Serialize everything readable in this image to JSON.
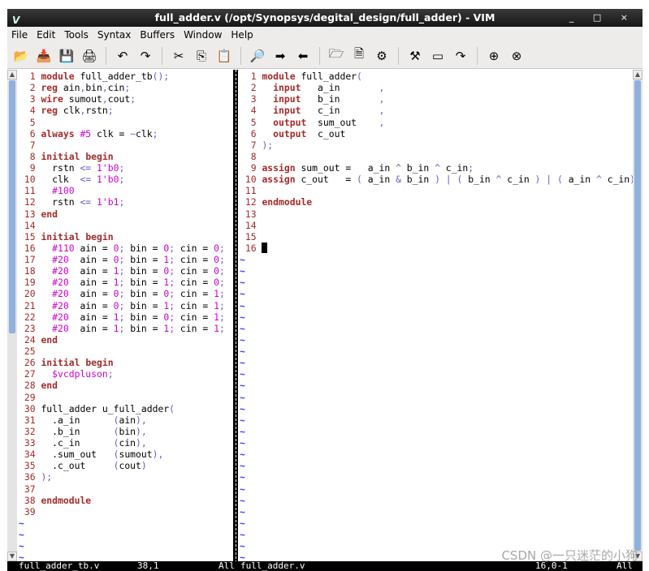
{
  "window": {
    "title": "full_adder.v (/opt/Synopsys/degital_design/full_adder) - VIM",
    "controls": "_ □ ×"
  },
  "menu": [
    "File",
    "Edit",
    "Tools",
    "Syntax",
    "Buffers",
    "Window",
    "Help"
  ],
  "toolbar": [
    {
      "name": "open-icon",
      "glyph": "📂"
    },
    {
      "name": "save-download-icon",
      "glyph": "📥"
    },
    {
      "name": "save-icon",
      "glyph": "💾"
    },
    {
      "name": "print-icon",
      "glyph": "🖨"
    },
    {
      "sep": true
    },
    {
      "name": "undo-icon",
      "glyph": "↶"
    },
    {
      "name": "redo-icon",
      "glyph": "↷"
    },
    {
      "sep": true
    },
    {
      "name": "cut-icon",
      "glyph": "✂"
    },
    {
      "name": "copy-icon",
      "glyph": "⎘"
    },
    {
      "name": "paste-icon",
      "glyph": "📋"
    },
    {
      "sep": true
    },
    {
      "name": "find-replace-icon",
      "glyph": "🔎"
    },
    {
      "name": "find-next-icon",
      "glyph": "➡"
    },
    {
      "name": "find-prev-icon",
      "glyph": "⬅"
    },
    {
      "sep": true
    },
    {
      "name": "load-session-icon",
      "glyph": "🗁"
    },
    {
      "name": "save-session-icon",
      "glyph": "🗎"
    },
    {
      "name": "run-script-icon",
      "glyph": "⚙"
    },
    {
      "sep": true
    },
    {
      "name": "make-icon",
      "glyph": "⚒"
    },
    {
      "name": "shell-icon",
      "glyph": "▭"
    },
    {
      "name": "jump-tag-icon",
      "glyph": "↷"
    },
    {
      "sep": true
    },
    {
      "name": "help-icon",
      "glyph": "⊕"
    },
    {
      "name": "find-help-icon",
      "glyph": "⊗"
    }
  ],
  "left_pane": {
    "lines": [
      "module full_adder_tb();",
      "reg ain,bin,cin;",
      "wire sumout,cout;",
      "reg clk,rstn;",
      "",
      "always #5 clk = ~clk;",
      "",
      "initial begin",
      "  rstn <= 1'b0;",
      "  clk  <= 1'b0;",
      "  #100",
      "  rstn <= 1'b1;",
      "end",
      "",
      "initial begin",
      "  #110 ain = 0; bin = 0; cin = 0;",
      "  #20  ain = 0; bin = 1; cin = 0;",
      "  #20  ain = 1; bin = 0; cin = 0;",
      "  #20  ain = 1; bin = 1; cin = 0;",
      "  #20  ain = 0; bin = 0; cin = 1;",
      "  #20  ain = 0; bin = 1; cin = 1;",
      "  #20  ain = 1; bin = 0; cin = 1;",
      "  #20  ain = 1; bin = 1; cin = 1;",
      "end",
      "",
      "initial begin",
      "  $vcdpluson;",
      "end",
      "",
      "full_adder u_full_adder(",
      "  .a_in      (ain),",
      "  .b_in      (bin),",
      "  .c_in      (cin),",
      "  .sum_out   (sumout),",
      "  .c_out     (cout)",
      ");",
      "",
      "endmodule",
      ""
    ],
    "status": {
      "file": "full_adder_tb.v",
      "pos": "38,1",
      "scroll": "All"
    }
  },
  "right_pane": {
    "lines": [
      "module full_adder(",
      "  input   a_in       ,",
      "  input   b_in       ,",
      "  input   c_in       ,",
      "  output  sum_out    ,",
      "  output  c_out",
      ");",
      "",
      "assign sum_out =   a_in ^ b_in ^ c_in;",
      "assign c_out   = ( a_in & b_in ) | ( b_in ^ c_in ) | ( a_in ^ c_in);",
      "",
      "endmodule",
      "",
      "",
      "",
      ""
    ],
    "status": {
      "file": "full_adder.v",
      "pos": "16,0-1",
      "scroll": "All"
    }
  },
  "watermark": "CSDN @一只迷茫的小狗"
}
